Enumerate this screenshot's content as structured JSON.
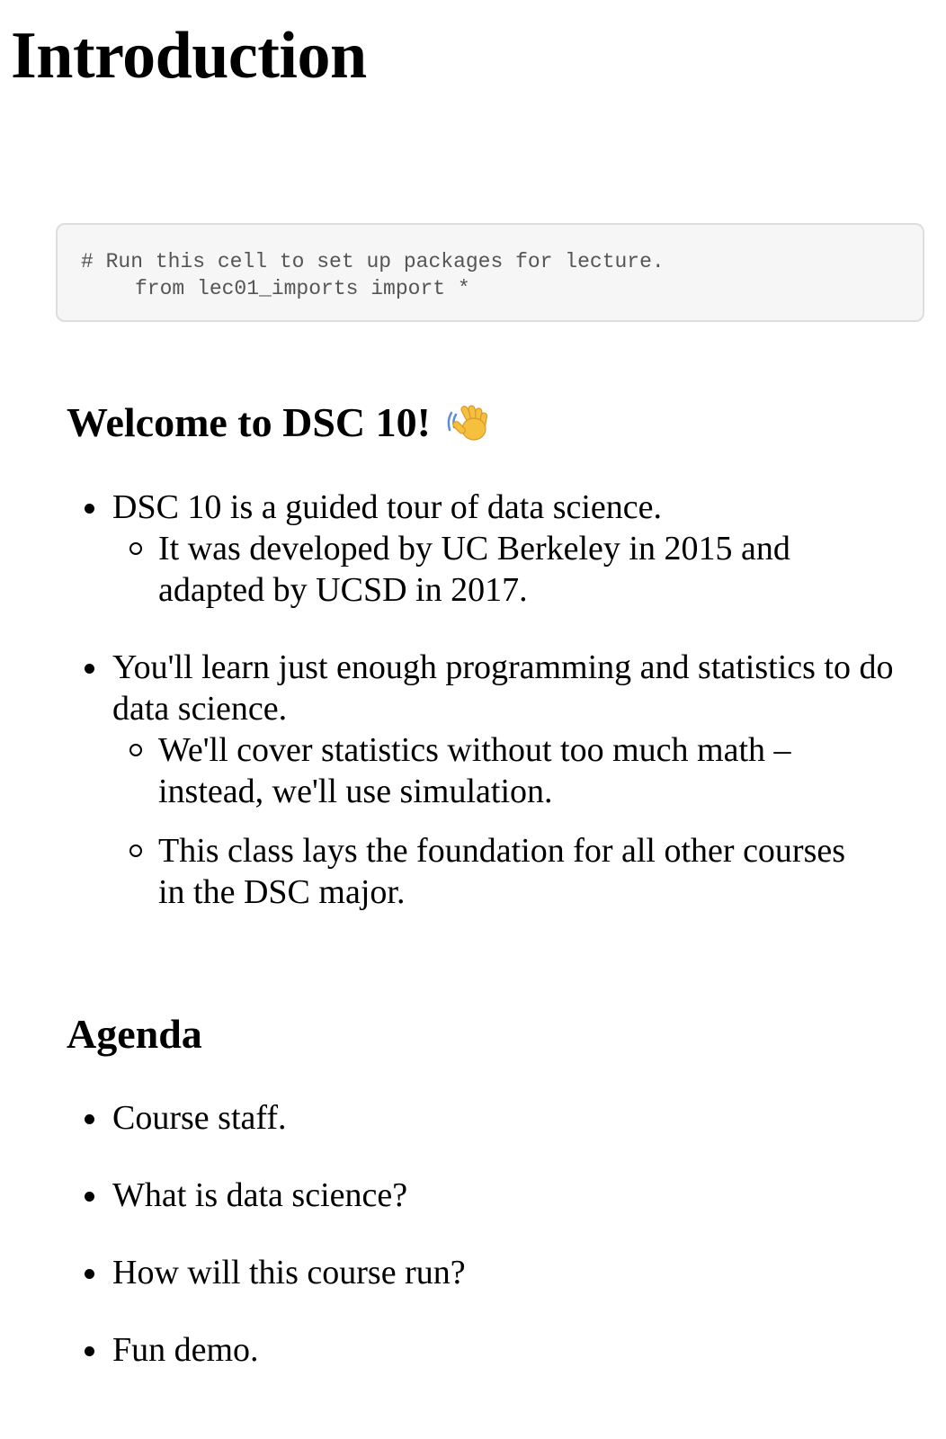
{
  "title": "Introduction",
  "code_cell": {
    "line1": "# Run this cell to set up packages for lecture.",
    "line2": "from lec01_imports import *"
  },
  "welcome": {
    "heading": "Welcome to DSC 10!",
    "icon": "waving-hand-icon",
    "items": [
      {
        "text": "DSC 10 is a guided tour of data science.",
        "sub": [
          "It was developed by UC Berkeley in 2015 and adapted by UCSD in 2017."
        ]
      },
      {
        "text": "You'll learn just enough programming and statistics to do data science.",
        "sub": [
          "We'll cover statistics without too much math – instead, we'll use simulation.",
          "This class lays the foundation for all other courses in the DSC major."
        ]
      }
    ]
  },
  "agenda": {
    "heading": "Agenda",
    "items": [
      "Course staff.",
      "What is data science?",
      "How will this course run?",
      "Fun demo."
    ]
  }
}
